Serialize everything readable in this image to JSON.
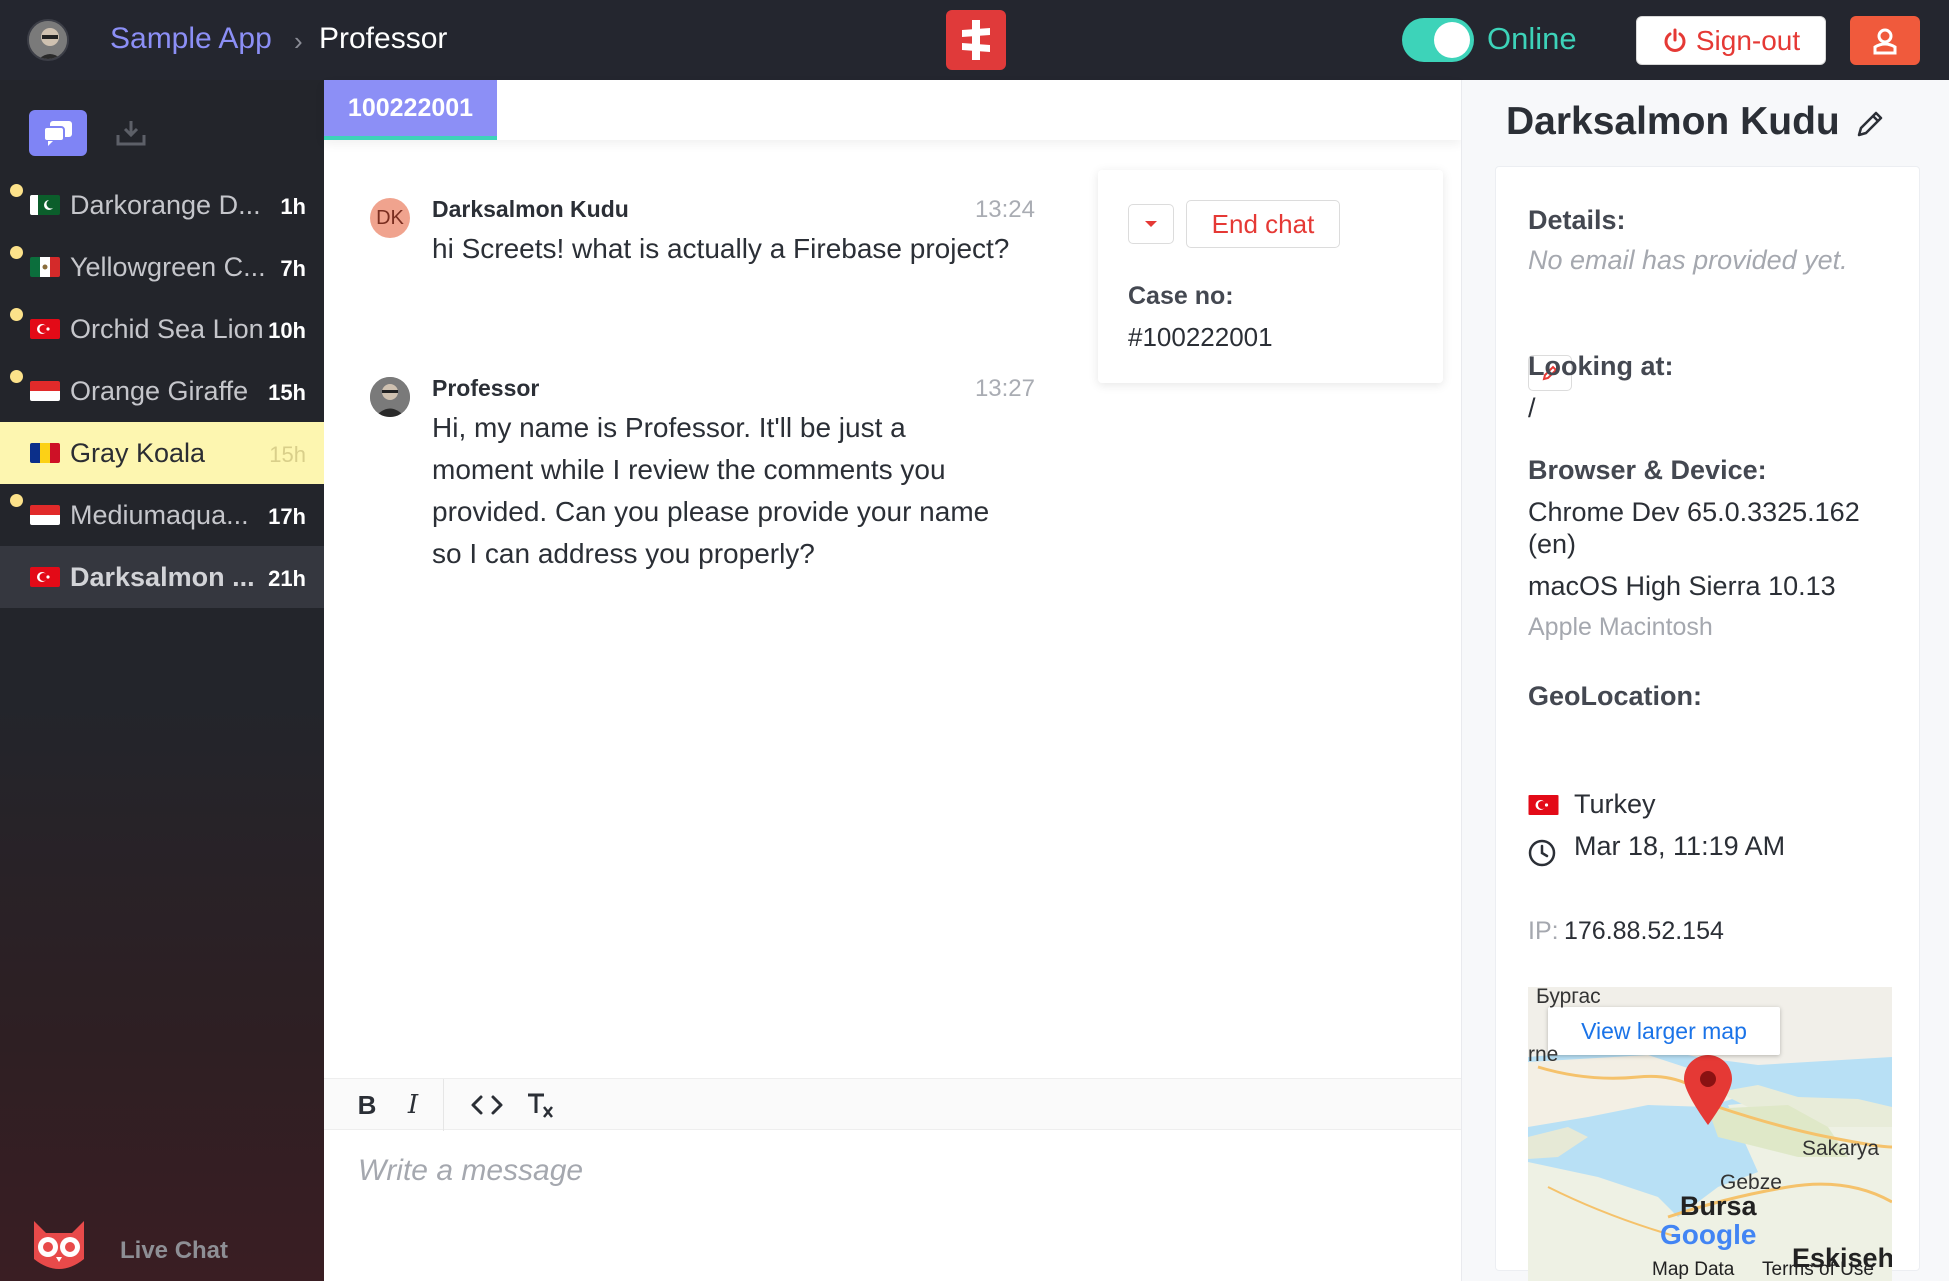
{
  "topbar": {
    "app_name": "Sample App",
    "separator": "›",
    "current_user": "Professor",
    "status_label": "Online",
    "signout_label": "Sign-out",
    "accent": "#8c8ff6",
    "online_color": "#3dd3b9",
    "logo_color": "#e03a3a"
  },
  "sidebar": {
    "tabs": [
      {
        "icon": "chat-bubbles-icon",
        "active": true
      },
      {
        "icon": "download-icon",
        "active": false
      }
    ],
    "conversations": [
      {
        "name": "Darkorange D...",
        "time": "1h",
        "flag": "pakistan",
        "unread": true,
        "state": "normal"
      },
      {
        "name": "Yellowgreen C...",
        "time": "7h",
        "flag": "mexico",
        "unread": true,
        "state": "normal"
      },
      {
        "name": "Orchid Sea Lion",
        "time": "10h",
        "flag": "turkey",
        "unread": true,
        "state": "normal"
      },
      {
        "name": "Orange Giraffe",
        "time": "15h",
        "flag": "indonesia",
        "unread": true,
        "state": "normal"
      },
      {
        "name": "Gray Koala",
        "time": "15h",
        "flag": "romania",
        "unread": false,
        "state": "highlighted"
      },
      {
        "name": "Mediumaqua...",
        "time": "17h",
        "flag": "indonesia",
        "unread": true,
        "state": "normal"
      },
      {
        "name": "Darksalmon ...",
        "time": "21h",
        "flag": "turkey",
        "unread": false,
        "state": "selected"
      }
    ],
    "footer_label": "Live Chat"
  },
  "chat": {
    "tab_label": "100222001",
    "messages": [
      {
        "sender": "Darksalmon Kudu",
        "initials": "DK",
        "time": "13:24",
        "text": "hi Screets! what is actually a Firebase project?"
      },
      {
        "sender": "Professor",
        "time": "13:27",
        "text": "Hi, my name is Professor. It'll be just a moment while I review the comments you provided. Can you please provide your name so I can address you properly?"
      }
    ],
    "case_card": {
      "end_chat_label": "End chat",
      "case_label": "Case no:",
      "case_value": "#100222001"
    },
    "toolbar": {
      "bold": "B",
      "italic": "I"
    },
    "composer_placeholder": "Write a message"
  },
  "visitor": {
    "name": "Darksalmon Kudu",
    "details_label": "Details:",
    "details_value": "No email has provided yet.",
    "looking_label": "Looking at:",
    "looking_value": "/",
    "browser_label": "Browser & Device:",
    "browser_line1": "Chrome Dev 65.0.3325.162",
    "browser_line2": "(en)",
    "os": "macOS High Sierra 10.13",
    "device": "Apple Macintosh",
    "geo_label": "GeoLocation:",
    "country": "Turkey",
    "local_time": "Mar 18, 11:19 AM",
    "ip_label": "IP:",
    "ip_value": "176.88.52.154",
    "map": {
      "button": "View larger map",
      "labels": [
        "Бургас",
        "rne",
        "Sakarya",
        "Gebze",
        "Bursa",
        "Eskiseh"
      ],
      "google": "Google",
      "map_data": "Map Data",
      "terms": "Terms of Use"
    }
  }
}
